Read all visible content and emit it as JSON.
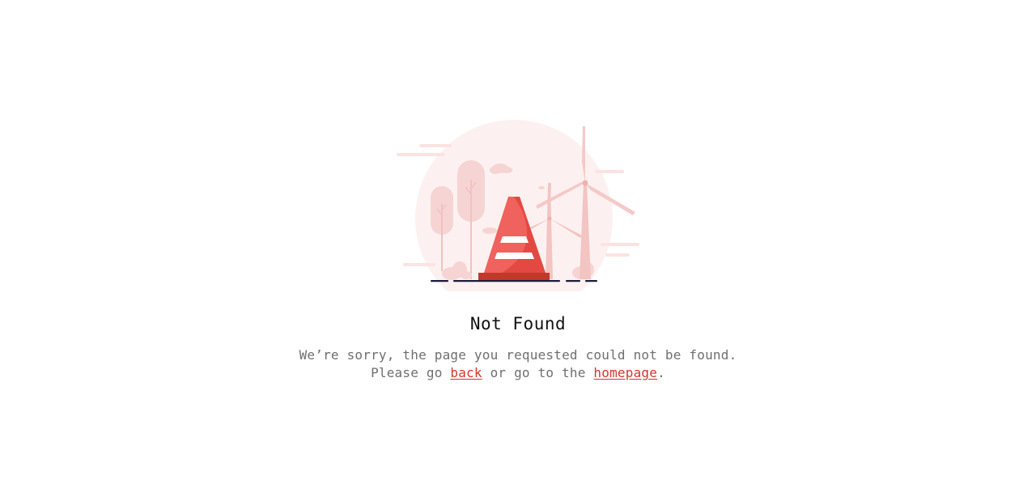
{
  "error": {
    "title": "Not Found",
    "line1": "We’re sorry, the page you requested could not be found.",
    "line2_prefix": "Please go ",
    "back_link": "back",
    "line2_middle": " or go to the ",
    "homepage_link": "homepage",
    "line2_suffix": "."
  },
  "illustration": {
    "subject": "traffic-cone-with-wind-turbines",
    "colors": {
      "cone_light": "#f0625d",
      "cone_dark": "#d9342b",
      "cone_base": "#c0392b",
      "background_pink": "#fbeceb",
      "ground_line": "#1c1c3a"
    }
  }
}
